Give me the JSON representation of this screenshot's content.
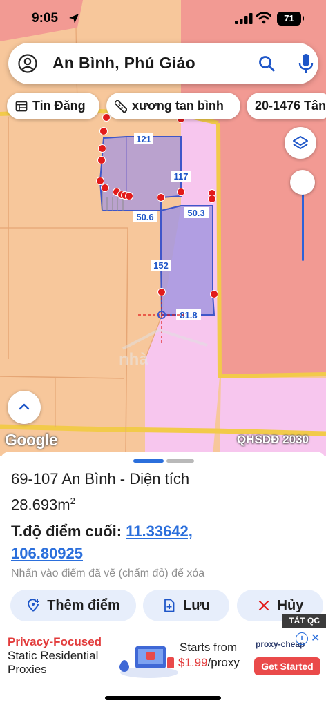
{
  "status_bar": {
    "time": "9:05",
    "battery": "71"
  },
  "search": {
    "query": "An Bình, Phú Giáo"
  },
  "chips": [
    {
      "label": "Tin Đăng",
      "icon": "list-icon"
    },
    {
      "label": "xương tan bình",
      "icon": "ruler-icon"
    },
    {
      "label": "20-1476 Tân"
    }
  ],
  "map": {
    "lot_dimensions": [
      "121",
      "117",
      "50.6",
      "50.3",
      "152",
      "81.8"
    ],
    "watermark": "nhà",
    "attribution": "Google",
    "plan_label": "QHSDĐ 2030",
    "colors": {
      "farmland": "#f7c79b",
      "residential": "#f29a93",
      "special": "#f7c6ee",
      "lot_fill": "#a596df",
      "roads": "#f2ca4a",
      "marker": "#e21b1b"
    }
  },
  "sheet": {
    "title": "69-107 An Bình - Diện tích",
    "area": "28.693m",
    "area_unit_sup": "2",
    "last_point_label": "T.độ điểm cuối:",
    "last_point_lat": "11.33642,",
    "last_point_lng": "106.80925",
    "hint": "Nhấn vào điểm đã vẽ (chấm đỏ) để xóa",
    "buttons": {
      "add_point": "Thêm điểm",
      "save": "Lưu",
      "cancel": "Hủy"
    }
  },
  "ad": {
    "close_label": "TẮT QC",
    "headline": "Privacy-Focused",
    "subline": "Static Residential Proxies",
    "starts_from": "Starts from",
    "price": "$1.99",
    "price_unit": "/proxy",
    "brand": "proxy-cheap",
    "cta": "Get Started"
  }
}
